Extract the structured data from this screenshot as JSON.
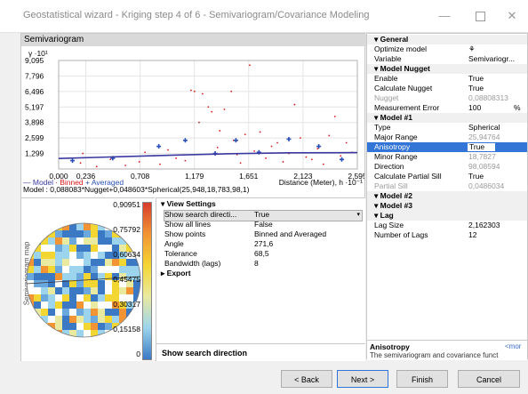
{
  "window": {
    "title": "Geostatistical wizard - Kriging step 4 of 6 - Semivariogram/Covariance Modeling"
  },
  "semivariogram": {
    "header": "Semivariogram",
    "legend": [
      "— Model",
      "· Binned",
      "+ Averaged"
    ],
    "model_formula": "Model : 0,088083*Nugget+0,048603*Spherical(25,948,18,783,98,1)"
  },
  "chart_data": {
    "type": "scatter",
    "ylabel": "γ ·10¹",
    "xlabel": "Distance (Meter), h ·10⁻¹",
    "xlim": [
      0,
      2.595
    ],
    "ylim": [
      0,
      9.095
    ],
    "x_ticks": [
      "0,000",
      "0,236",
      "0,708",
      "1,179",
      "1,651",
      "2,123",
      "2,595"
    ],
    "x_tick_values": [
      0,
      0.236,
      0.708,
      1.179,
      1.651,
      2.123,
      2.595
    ],
    "y_ticks": [
      "9,095",
      "7,796",
      "6,496",
      "5,197",
      "3,898",
      "2,599",
      "1,299"
    ],
    "y_tick_values": [
      9.095,
      7.796,
      6.496,
      5.197,
      3.898,
      2.599,
      1.299
    ],
    "grid": true,
    "series": [
      {
        "name": "Binned",
        "color": "#d7191c",
        "marker": "dot",
        "points": [
          [
            0.19,
            0.5
          ],
          [
            0.21,
            1.3
          ],
          [
            0.33,
            0.2
          ],
          [
            0.45,
            0.8
          ],
          [
            0.58,
            0.3
          ],
          [
            0.7,
            0.6
          ],
          [
            0.75,
            1.4
          ],
          [
            0.83,
            1.1
          ],
          [
            0.88,
            0.4
          ],
          [
            0.95,
            1.6
          ],
          [
            1.02,
            0.9
          ],
          [
            1.1,
            0.7
          ],
          [
            1.15,
            6.6
          ],
          [
            1.18,
            6.5
          ],
          [
            1.22,
            3.9
          ],
          [
            1.25,
            6.3
          ],
          [
            1.3,
            5.2
          ],
          [
            1.33,
            4.8
          ],
          [
            1.38,
            1.8
          ],
          [
            1.4,
            3.2
          ],
          [
            1.44,
            5.0
          ],
          [
            1.5,
            6.5
          ],
          [
            1.52,
            2.4
          ],
          [
            1.55,
            1.2
          ],
          [
            1.58,
            0.5
          ],
          [
            1.62,
            2.9
          ],
          [
            1.66,
            8.7
          ],
          [
            1.7,
            1.5
          ],
          [
            1.75,
            3.1
          ],
          [
            1.8,
            0.9
          ],
          [
            1.85,
            1.9
          ],
          [
            1.9,
            2.2
          ],
          [
            1.95,
            0.6
          ],
          [
            2.0,
            1.3
          ],
          [
            2.05,
            5.4
          ],
          [
            2.1,
            2.6
          ],
          [
            2.15,
            1.0
          ],
          [
            2.2,
            0.8
          ],
          [
            2.25,
            1.7
          ],
          [
            2.3,
            0.4
          ],
          [
            2.35,
            2.8
          ],
          [
            2.4,
            4.4
          ],
          [
            2.45,
            1.1
          ],
          [
            2.5,
            2.2
          ],
          [
            2.55,
            1.4
          ]
        ]
      },
      {
        "name": "Averaged",
        "color": "#2b4fb8",
        "marker": "plus",
        "points": [
          [
            0.12,
            0.7
          ],
          [
            0.47,
            0.9
          ],
          [
            0.87,
            1.9
          ],
          [
            1.1,
            2.4
          ],
          [
            1.36,
            1.3
          ],
          [
            1.54,
            2.4
          ],
          [
            1.74,
            1.4
          ],
          [
            2.0,
            2.5
          ],
          [
            2.26,
            1.9
          ],
          [
            2.46,
            0.8
          ]
        ]
      },
      {
        "name": "Model",
        "color": "#3a3aa0",
        "marker": "line",
        "points": [
          [
            0,
            0.88
          ],
          [
            0.5,
            1.02
          ],
          [
            1.0,
            1.16
          ],
          [
            1.5,
            1.28
          ],
          [
            2.0,
            1.36
          ],
          [
            2.595,
            1.37
          ]
        ]
      }
    ]
  },
  "map": {
    "ylabel": "Semivariogram map",
    "scale": [
      "0,90951",
      "0,75792",
      "0,60634",
      "0,45475",
      "0,30317",
      "0,15158",
      "0"
    ]
  },
  "view_settings": {
    "section": "View Settings",
    "rows": [
      {
        "key": "Show search directi...",
        "value": "True"
      },
      {
        "key": "Show all lines",
        "value": "False"
      },
      {
        "key": "Show points",
        "value": "Binned and Averaged"
      },
      {
        "key": "Angle",
        "value": "271,6"
      },
      {
        "key": "Tolerance",
        "value": "68,5"
      },
      {
        "key": "Bandwidth (lags)",
        "value": "8"
      }
    ],
    "export": "Export",
    "footer": "Show search direction"
  },
  "properties": {
    "general": {
      "label": "General",
      "rows": [
        {
          "k": "Optimize model",
          "v": "⚘"
        },
        {
          "k": "Variable",
          "v": "Semivariogr..."
        }
      ]
    },
    "nugget": {
      "label": "Model Nugget",
      "rows": [
        {
          "k": "Enable",
          "v": "True"
        },
        {
          "k": "Calculate Nugget",
          "v": "True"
        },
        {
          "k": "Nugget",
          "v": "0,08808313"
        },
        {
          "k": "Measurement Error",
          "v": "100",
          "v2": "%"
        }
      ]
    },
    "model1": {
      "label": "Model #1",
      "rows": [
        {
          "k": "Type",
          "v": "Spherical"
        },
        {
          "k": "Major Range",
          "v": "25,94764"
        },
        {
          "k": "Anisotropy",
          "v": "True"
        },
        {
          "k": "Minor Range",
          "v": "18,7827"
        },
        {
          "k": "Direction",
          "v": "98,08594"
        },
        {
          "k": "Calculate Partial Sill",
          "v": "True"
        },
        {
          "k": "Partial Sill",
          "v": "0,0486034"
        }
      ]
    },
    "model2": {
      "label": "Model #2"
    },
    "model3": {
      "label": "Model #3"
    },
    "lag": {
      "label": "Lag",
      "rows": [
        {
          "k": "Lag Size",
          "v": "2,162303"
        },
        {
          "k": "Number of Lags",
          "v": "12"
        }
      ]
    },
    "help": {
      "title": "Anisotropy",
      "more": "<mor",
      "text": "The semivariogram and covariance funct"
    }
  },
  "buttons": {
    "back": "< Back",
    "next": "Next >",
    "finish": "Finish",
    "cancel": "Cancel"
  }
}
